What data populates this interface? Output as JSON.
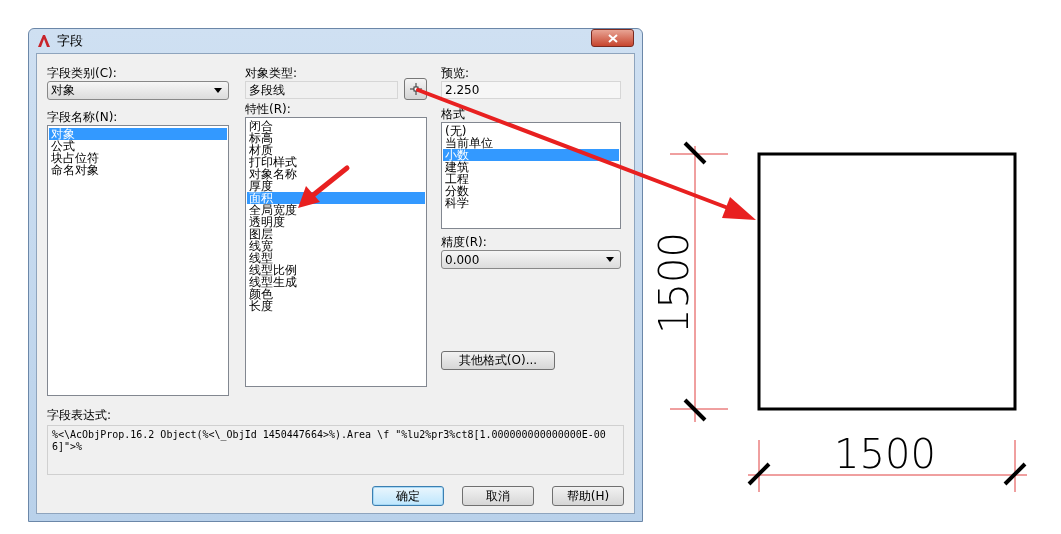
{
  "window": {
    "title": "字段"
  },
  "field_category": {
    "label": "字段类别(C):",
    "value": "对象"
  },
  "field_names": {
    "label": "字段名称(N):",
    "items": [
      {
        "label": "对象",
        "selected": true
      },
      {
        "label": "公式",
        "selected": false
      },
      {
        "label": "块占位符",
        "selected": false
      },
      {
        "label": "命名对象",
        "selected": false
      }
    ]
  },
  "object_type": {
    "label": "对象类型:",
    "value": "多段线"
  },
  "properties": {
    "label": "特性(R):",
    "items": [
      {
        "label": "闭合",
        "selected": false
      },
      {
        "label": "标高",
        "selected": false
      },
      {
        "label": "材质",
        "selected": false
      },
      {
        "label": "打印样式",
        "selected": false
      },
      {
        "label": "对象名称",
        "selected": false
      },
      {
        "label": "厚度",
        "selected": false
      },
      {
        "label": "面积",
        "selected": true
      },
      {
        "label": "全局宽度",
        "selected": false
      },
      {
        "label": "透明度",
        "selected": false
      },
      {
        "label": "图层",
        "selected": false
      },
      {
        "label": "线宽",
        "selected": false
      },
      {
        "label": "线型",
        "selected": false
      },
      {
        "label": "线型比例",
        "selected": false
      },
      {
        "label": "线型生成",
        "selected": false
      },
      {
        "label": "颜色",
        "selected": false
      },
      {
        "label": "长度",
        "selected": false
      }
    ]
  },
  "preview": {
    "label": "预览:",
    "value": "2.250"
  },
  "format": {
    "label": "格式",
    "items": [
      {
        "label": "(无)",
        "selected": false
      },
      {
        "label": "当前单位",
        "selected": false
      },
      {
        "label": "小数",
        "selected": true
      },
      {
        "label": "建筑",
        "selected": false
      },
      {
        "label": "工程",
        "selected": false
      },
      {
        "label": "分数",
        "selected": false
      },
      {
        "label": "科学",
        "selected": false
      }
    ]
  },
  "precision": {
    "label": "精度(R):",
    "value": "0.000"
  },
  "other_format_button": "其他格式(O)...",
  "expression": {
    "label": "字段表达式:",
    "value": "%<\\AcObjProp.16.2 Object(%<\\_ObjId 1450447664>%).Area \\f \"%lu2%pr3%ct8[1.000000000000000E-006]\">%"
  },
  "buttons": [
    {
      "label": "确定",
      "default": true
    },
    {
      "label": "取消",
      "default": false
    },
    {
      "label": "帮助(H)",
      "default": false
    }
  ],
  "drawing": {
    "height_dimension": "1500",
    "width_dimension": "1500"
  }
}
